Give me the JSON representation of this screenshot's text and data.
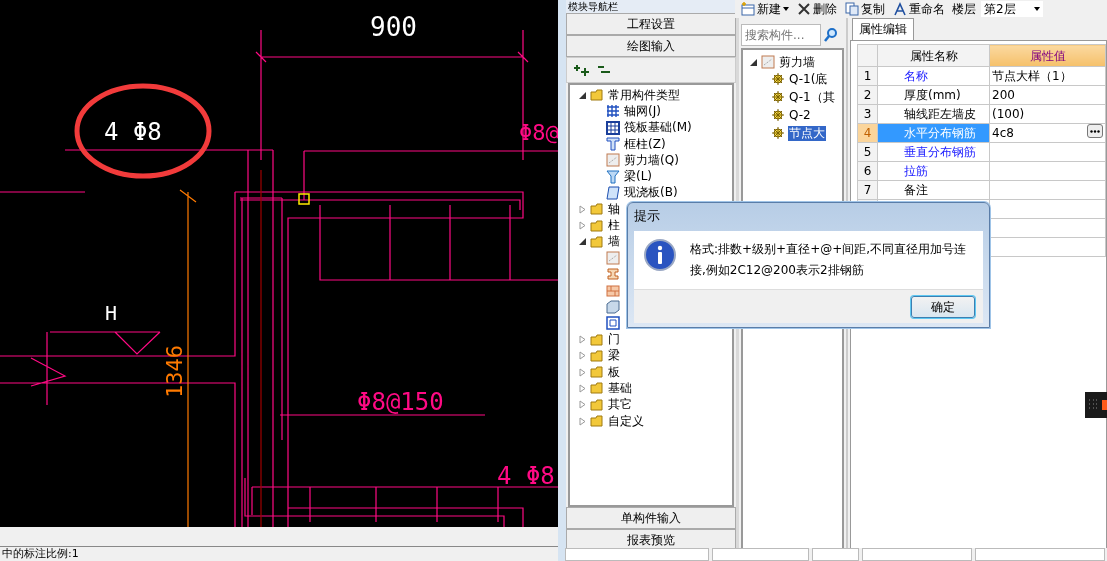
{
  "cad": {
    "dimension": "900",
    "highlighted_callout": "4 Φ8",
    "rebar_label_top": "Φ8@",
    "elevation_mark": "H",
    "vertical_dimension": "1346",
    "rebar_label_middle": "Φ8@150",
    "rebar_label_bottom": "4 Φ8",
    "status_text": "中的标注比例:1"
  },
  "navigator": {
    "title": "模块导航栏",
    "sections_top": [
      "工程设置",
      "绘图输入"
    ],
    "tree": [
      {
        "label": "常用构件类型",
        "expanded": true,
        "children": [
          {
            "label": "轴网(J)",
            "kind": "grid"
          },
          {
            "label": "筏板基础(M)",
            "kind": "raft"
          },
          {
            "label": "框柱(Z)",
            "kind": "column"
          },
          {
            "label": "剪力墙(Q)",
            "kind": "wall"
          },
          {
            "label": "梁(L)",
            "kind": "beam"
          },
          {
            "label": "现浇板(B)",
            "kind": "slab"
          }
        ]
      },
      {
        "label": "轴",
        "expanded": false
      },
      {
        "label": "柱",
        "expanded": false
      },
      {
        "label": "墙",
        "expanded": true,
        "children": [
          {
            "kind": "wall"
          },
          {
            "kind": "lintel"
          },
          {
            "kind": "brick"
          },
          {
            "kind": "box"
          },
          {
            "kind": "window"
          }
        ]
      },
      {
        "label": "门",
        "expanded": false
      },
      {
        "label": "梁",
        "expanded": false
      },
      {
        "label": "板",
        "expanded": false
      },
      {
        "label": "基础",
        "expanded": false
      },
      {
        "label": "其它",
        "expanded": false
      },
      {
        "label": "自定义",
        "expanded": false
      }
    ],
    "sections_bottom": [
      "单构件输入",
      "报表预览"
    ]
  },
  "toolbar": [
    {
      "kind": "new",
      "label": "新建"
    },
    {
      "kind": "delete",
      "label": "删除"
    },
    {
      "kind": "copy",
      "label": "复制"
    },
    {
      "kind": "rename",
      "label": "重命名"
    }
  ],
  "floor": {
    "label": "楼层",
    "value": "第2层"
  },
  "components": {
    "search_placeholder": "搜索构件...",
    "tree": {
      "label": "剪力墙",
      "expanded": true,
      "children": [
        {
          "label": "Q-1(底",
          "selected": false
        },
        {
          "label": "Q-1（其",
          "selected": false
        },
        {
          "label": "Q-2",
          "selected": false
        },
        {
          "label": "节点大",
          "selected": true
        }
      ]
    }
  },
  "properties": {
    "tab": "属性编辑",
    "columns": [
      "属性名称",
      "属性值"
    ],
    "rows": [
      {
        "index": "1",
        "name": "名称",
        "value": "节点大样（1）",
        "linked": true,
        "selected": false,
        "picker": false
      },
      {
        "index": "2",
        "name": "厚度(mm)",
        "value": "200",
        "linked": false,
        "selected": false,
        "picker": false
      },
      {
        "index": "3",
        "name": "轴线距左墙皮",
        "value": "(100)",
        "linked": false,
        "selected": false,
        "picker": false
      },
      {
        "index": "4",
        "name": "水平分布钢筋",
        "value": "4c8",
        "linked": true,
        "selected": true,
        "picker": true
      },
      {
        "index": "5",
        "name": "垂直分布钢筋",
        "linked": true,
        "selected": false,
        "picker": false
      },
      {
        "index": "6",
        "name": "拉筋",
        "linked": true,
        "selected": false,
        "picker": false
      },
      {
        "index": "7",
        "name": "备注",
        "linked": false,
        "selected": false,
        "picker": false
      }
    ]
  },
  "dialog": {
    "title": "提示",
    "message": "格式:排数+级别+直径+@+间距,不同直径用加号连接,例如2C12@200表示2排钢筋",
    "button": "确定"
  }
}
